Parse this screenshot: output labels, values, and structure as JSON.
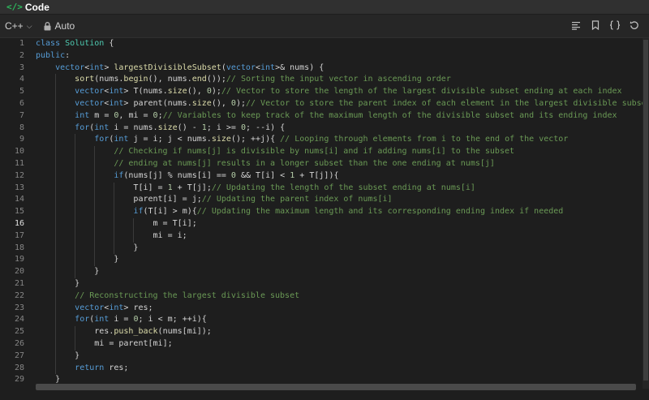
{
  "header": {
    "title": "Code"
  },
  "toolbar": {
    "language": "C++",
    "mode": "Auto"
  },
  "editor": {
    "active_line": 16,
    "lines": [
      "class Solution {",
      "public:",
      "    vector<int> largestDivisibleSubset(vector<int>& nums) {",
      "        sort(nums.begin(), nums.end());// Sorting the input vector in ascending order",
      "        vector<int> T(nums.size(), 0);// Vector to store the length of the largest divisible subset ending at each index",
      "        vector<int> parent(nums.size(), 0);// Vector to store the parent index of each element in the largest divisible subset",
      "        int m = 0, mi = 0;// Variables to keep track of the maximum length of the divisible subset and its ending index",
      "        for(int i = nums.size() - 1; i >= 0; --i) {",
      "            for(int j = i; j < nums.size(); ++j){ // Looping through elements from i to the end of the vector",
      "                // Checking if nums[j] is divisible by nums[i] and if adding nums[i] to the subset",
      "                // ending at nums[j] results in a longer subset than the one ending at nums[j]",
      "                if(nums[j] % nums[i] == 0 && T[i] < 1 + T[j]){",
      "                    T[i] = 1 + T[j];// Updating the length of the subset ending at nums[i]",
      "                    parent[i] = j;// Updating the parent index of nums[i]",
      "                    if(T[i] > m){// Updating the maximum length and its corresponding ending index if needed",
      "                        m = T[i];",
      "                        mi = i;",
      "                    }",
      "                }",
      "            }",
      "        }",
      "        // Reconstructing the largest divisible subset",
      "        vector<int> res;",
      "        for(int i = 0; i < m; ++i){",
      "            res.push_back(nums[mi]);",
      "            mi = parent[mi];",
      "        }",
      "        return res;",
      "    }"
    ]
  },
  "colors": {
    "keyword": "#569cd6",
    "comment": "#6a9955",
    "number": "#b5cea8",
    "function": "#dcdcaa",
    "type": "#4ec9b0",
    "variable": "#9cdcfe",
    "accent": "#2cbb5d"
  },
  "icons": {
    "title": "code-brackets-icon",
    "language_dropdown": "chevron-down-icon",
    "mode": "lock-icon",
    "toolbar": [
      "format-icon",
      "bookmark-icon",
      "braces-icon",
      "reset-icon"
    ]
  }
}
